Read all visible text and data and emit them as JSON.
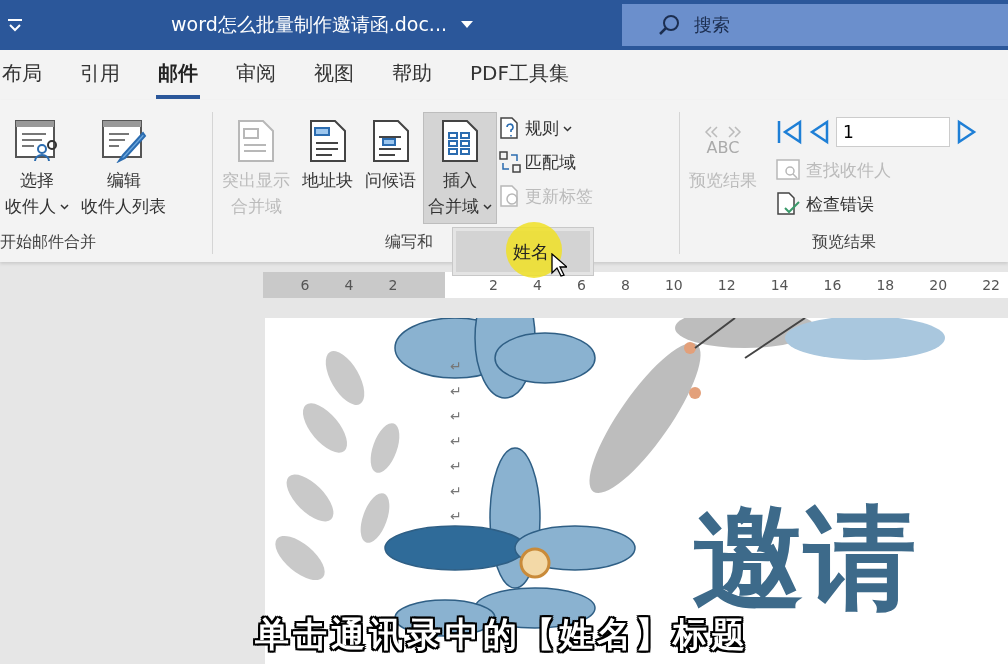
{
  "title_bar": {
    "title": "word怎么批量制作邀请函.doc...",
    "search_placeholder": "搜索"
  },
  "tabs": [
    {
      "label": "布局",
      "selected": false
    },
    {
      "label": "引用",
      "selected": false
    },
    {
      "label": "邮件",
      "selected": true
    },
    {
      "label": "审阅",
      "selected": false
    },
    {
      "label": "视图",
      "selected": false
    },
    {
      "label": "帮助",
      "selected": false
    },
    {
      "label": "PDF工具集",
      "selected": false
    }
  ],
  "ribbon_groups": [
    {
      "label": "开始邮件合并",
      "items": [
        {
          "kind": "large",
          "lines": [
            "选择",
            "收件人"
          ],
          "dropdown": true,
          "disabled": false,
          "pressed": false
        },
        {
          "kind": "large",
          "lines": [
            "编辑",
            "收件人列表"
          ],
          "dropdown": false,
          "disabled": false,
          "pressed": false
        }
      ]
    },
    {
      "label": "编写和",
      "items": [
        {
          "kind": "large",
          "lines": [
            "突出显示",
            "合并域"
          ],
          "dropdown": false,
          "disabled": true,
          "pressed": false
        },
        {
          "kind": "large",
          "lines": [
            "地址块"
          ],
          "dropdown": false,
          "disabled": false,
          "pressed": false
        },
        {
          "kind": "large",
          "lines": [
            "问候语"
          ],
          "dropdown": false,
          "disabled": false,
          "pressed": false
        },
        {
          "kind": "large",
          "lines": [
            "插入",
            "合并域"
          ],
          "dropdown": true,
          "disabled": false,
          "pressed": true
        },
        {
          "kind": "small",
          "label": "规则",
          "dropdown": true,
          "disabled": false
        },
        {
          "kind": "small",
          "label": "匹配域",
          "dropdown": false,
          "disabled": false
        },
        {
          "kind": "small",
          "label": "更新标签",
          "dropdown": false,
          "disabled": true
        }
      ]
    },
    {
      "label": "预览结果",
      "items": [
        {
          "kind": "large",
          "top": "ABC",
          "lines": [
            "预览结果"
          ],
          "dropdown": false,
          "disabled": true,
          "pressed": false
        },
        {
          "kind": "nav",
          "value": "1"
        },
        {
          "kind": "small",
          "label": "查找收件人",
          "dropdown": false,
          "disabled": true
        },
        {
          "kind": "small",
          "label": "检查错误",
          "dropdown": false,
          "disabled": false
        }
      ]
    }
  ],
  "dropdown_menu": {
    "items": [
      {
        "label": "姓名",
        "selected": true
      }
    ]
  },
  "ruler": {
    "left_numbers": [
      "6",
      "4",
      "2"
    ],
    "right_numbers": [
      "2",
      "4",
      "6",
      "8",
      "10",
      "12",
      "14",
      "16",
      "18",
      "20",
      "22"
    ]
  },
  "document": {
    "paragraph_marks": [
      "↵",
      "↵",
      "↵",
      "↵",
      "↵",
      "↵",
      "↵"
    ],
    "heading": "邀请"
  },
  "caption": "单击通讯录中的【姓名】标题"
}
